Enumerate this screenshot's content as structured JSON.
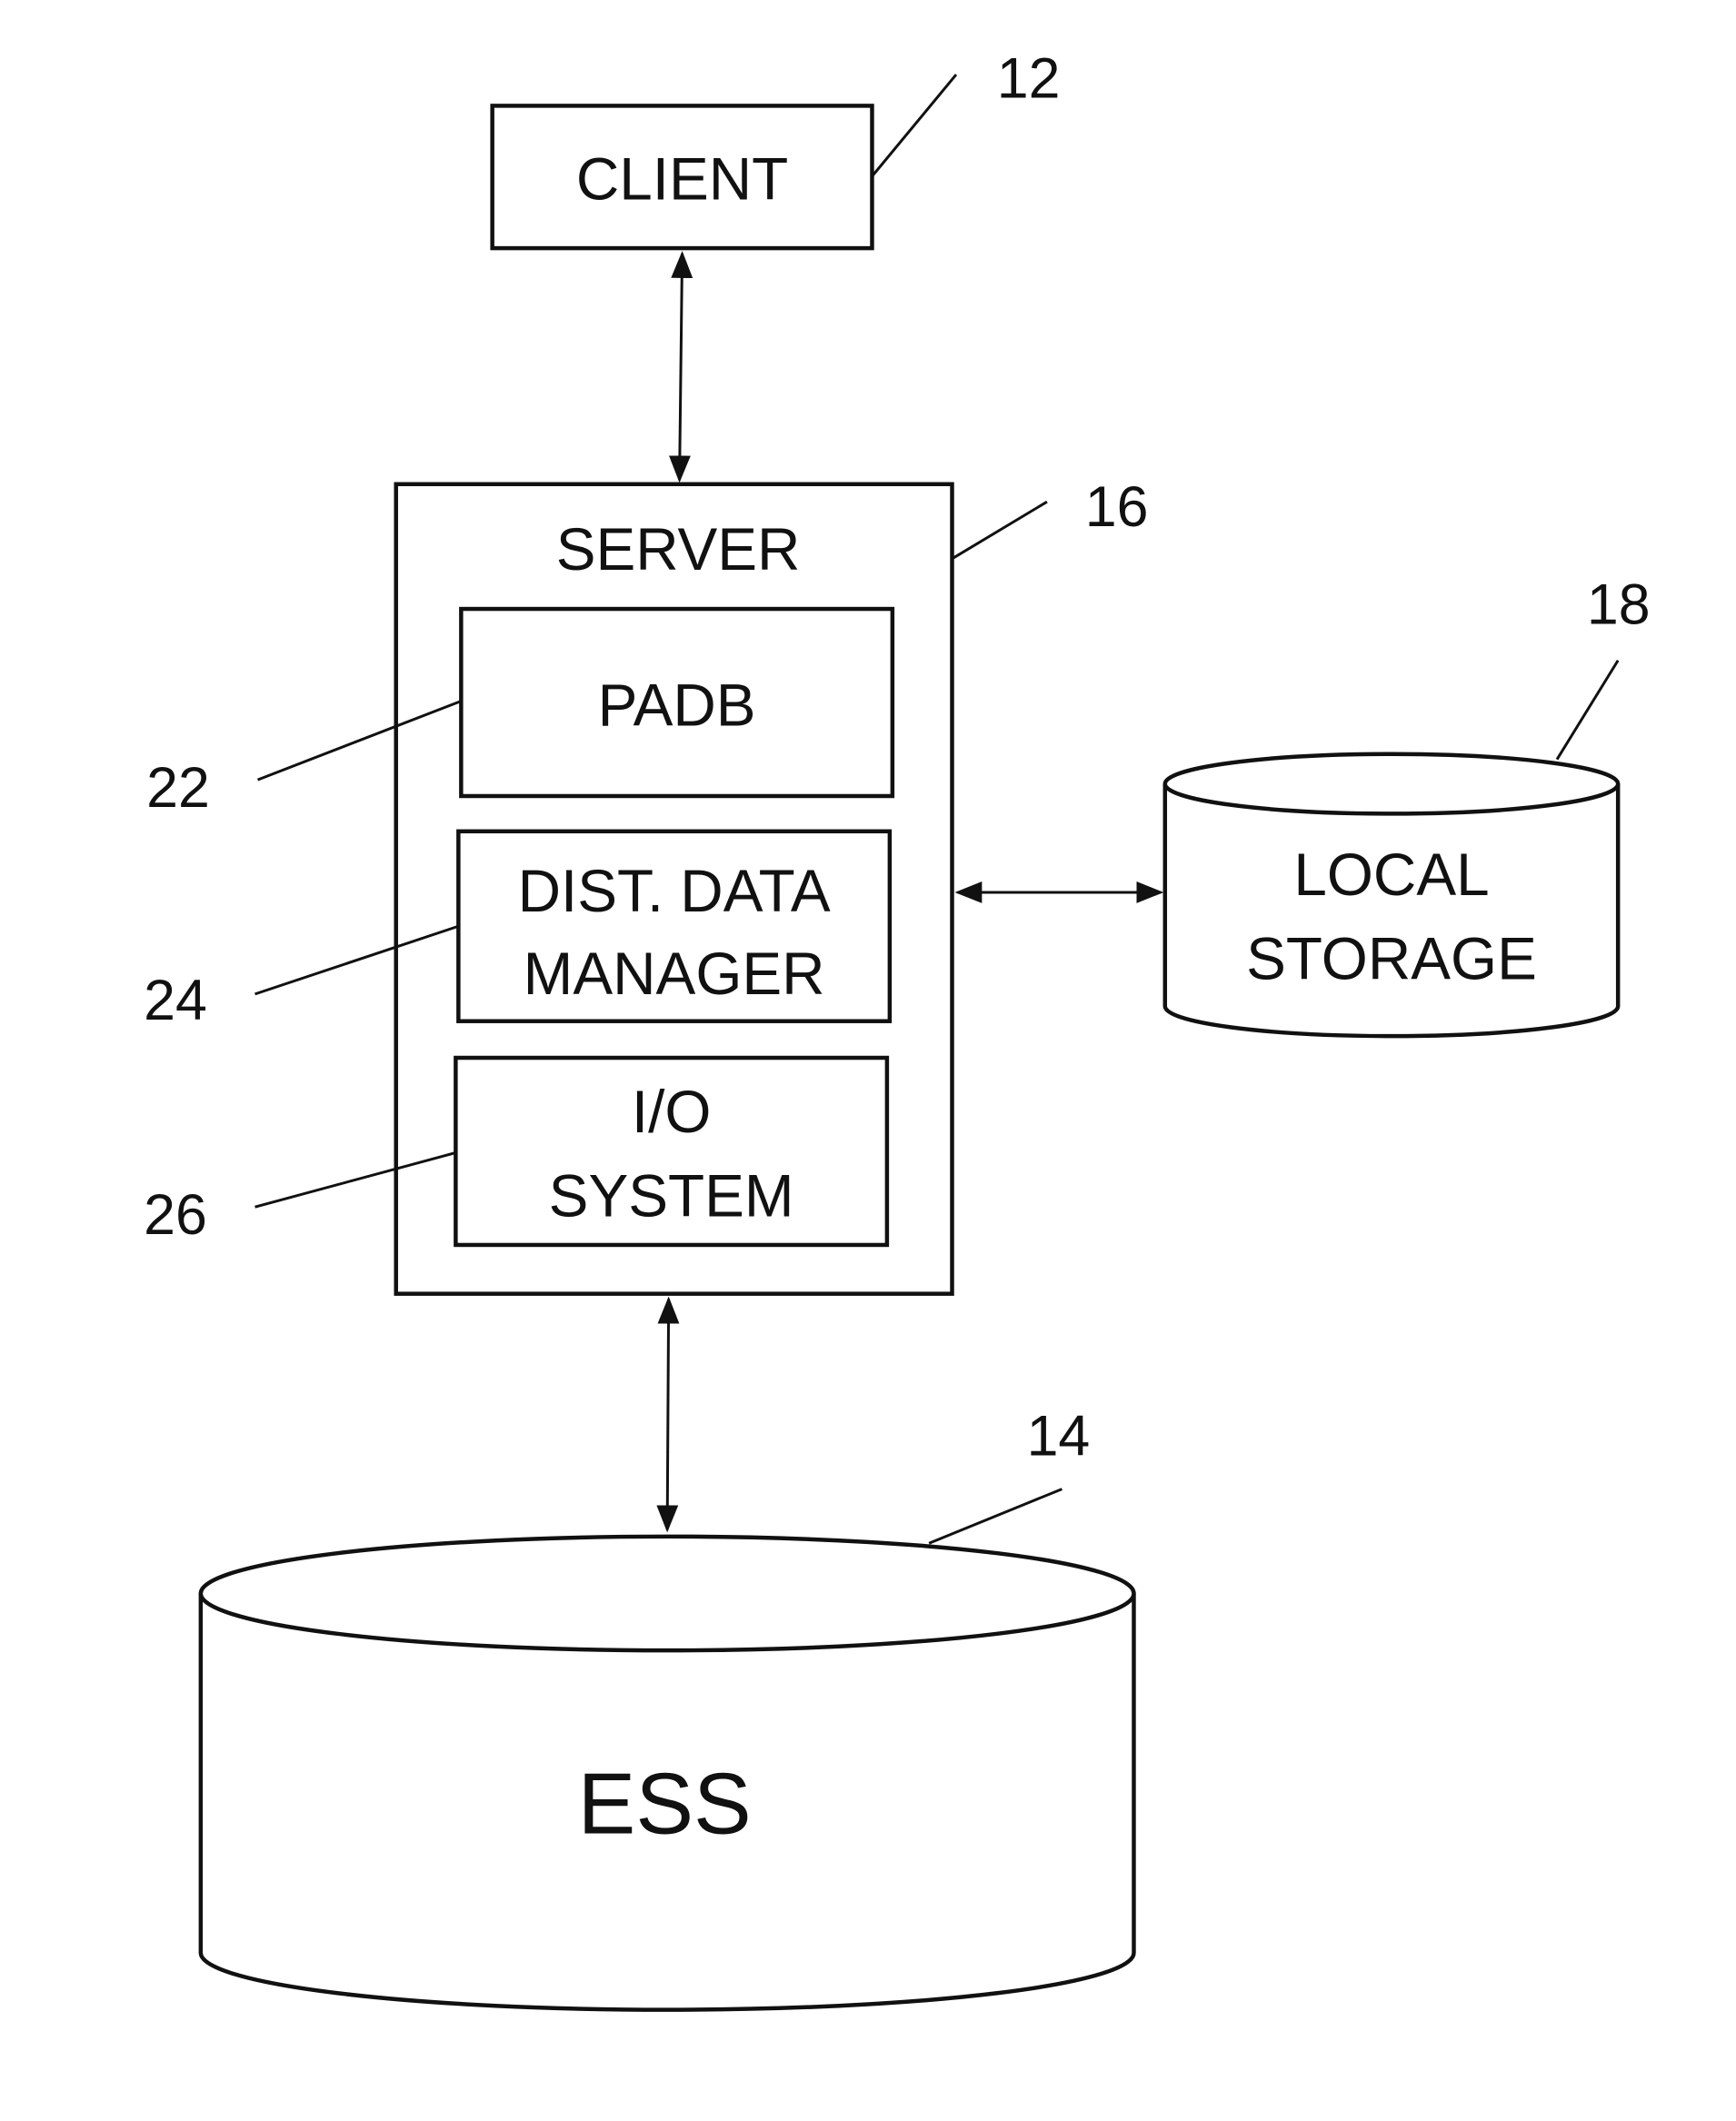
{
  "diagram": {
    "client": {
      "label": "CLIENT",
      "ref": "12"
    },
    "server": {
      "label": "SERVER",
      "ref": "16"
    },
    "padb": {
      "label": "PADB",
      "ref": "22"
    },
    "dist_data_manager": {
      "line1": "DIST. DATA",
      "line2": "MANAGER",
      "ref": "24"
    },
    "io_system": {
      "line1": "I/O",
      "line2": "SYSTEM",
      "ref": "26"
    },
    "local_storage": {
      "line1": "LOCAL",
      "line2": "STORAGE",
      "ref": "18"
    },
    "ess": {
      "label": "ESS",
      "ref": "14"
    }
  }
}
